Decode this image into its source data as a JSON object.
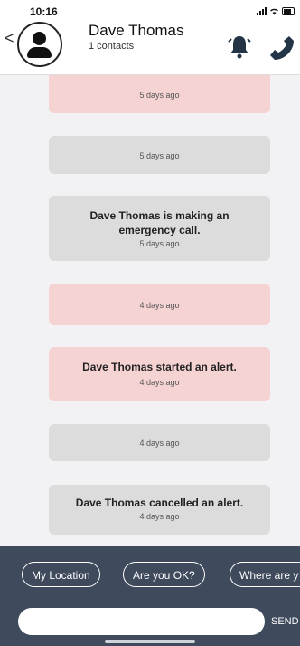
{
  "status": {
    "time": "10:16"
  },
  "header": {
    "back": "<",
    "name": "Dave Thomas",
    "subtitle": "1 contacts"
  },
  "messages": [
    {
      "title": "",
      "time": "5 days ago",
      "color": "pink"
    },
    {
      "title": "",
      "time": "5 days ago",
      "color": "gray"
    },
    {
      "title": "Dave Thomas is making an emergency call.",
      "time": "5 days ago",
      "color": "gray"
    },
    {
      "title": "",
      "time": "4 days ago",
      "color": "pink"
    },
    {
      "title": "Dave Thomas started an alert.",
      "time": "4 days ago",
      "color": "pink"
    },
    {
      "title": "",
      "time": "4 days ago",
      "color": "gray"
    },
    {
      "title": "Dave Thomas cancelled an alert.",
      "time": "4 days ago",
      "color": "gray"
    }
  ],
  "quick_replies": [
    "My Location",
    "Are you OK?",
    "Where are y"
  ],
  "composer": {
    "value": "",
    "placeholder": "",
    "send_label": "SEND"
  },
  "colors": {
    "pink": "#f6d3d3",
    "gray": "#dcdcdc",
    "footer": "#3f4a5c",
    "accent": "#e85a5a"
  }
}
